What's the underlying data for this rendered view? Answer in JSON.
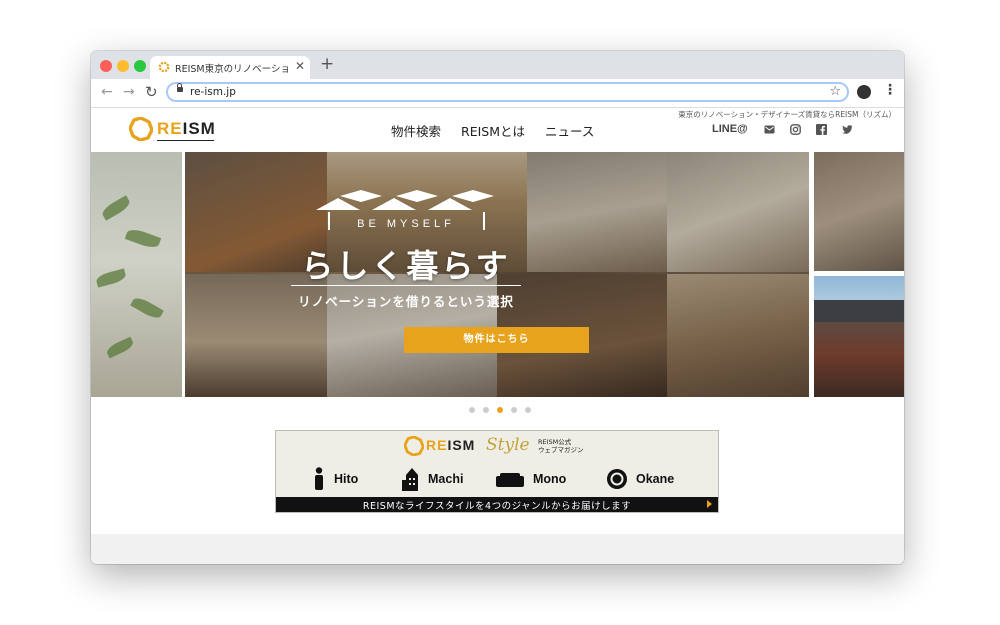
{
  "browser": {
    "tab_title": "REISM東京のリノベーション・デザ",
    "new_tab_label": "+",
    "url": "re-ism.jp"
  },
  "header": {
    "logo": {
      "re": "RE",
      "ism": "ISM"
    },
    "nav": [
      "物件検索",
      "REISMとは",
      "ニュース"
    ],
    "tagline": "東京のリノベーション・デザイナーズ賃貸ならREISM（リズム）",
    "line_label": "LINE@"
  },
  "hero": {
    "eyebrow": "BE MYSELF",
    "title": "らしく暮らす",
    "subtitle": "リノベーションを借りるという選択",
    "cta": "物件はこちら",
    "slides_count": 5,
    "active_slide": 3
  },
  "banner": {
    "logo": {
      "re": "RE",
      "ism": "ISM"
    },
    "style_word": "Style",
    "official": "REISM公式",
    "official_sub": "ウェブマガジン",
    "genres": [
      "Hito",
      "Machi",
      "Mono",
      "Okane"
    ],
    "bar_text": "REISMなライフスタイルを4つのジャンルからお届けします"
  },
  "colors": {
    "accent": "#e8a31c",
    "dark": "#111111"
  }
}
